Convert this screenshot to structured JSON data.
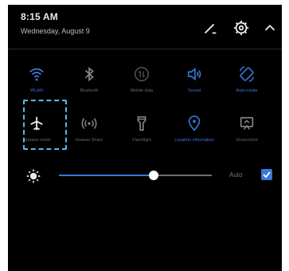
{
  "status": {
    "time": "8:15 AM",
    "date": "Wednesday, August 9"
  },
  "header_icons": [
    "edit-icon",
    "gear-icon",
    "chevron-up-icon"
  ],
  "tiles": [
    {
      "label": "WLAN",
      "icon": "wifi-icon",
      "active": true
    },
    {
      "label": "Bluetooth",
      "icon": "bluetooth-icon",
      "active": false
    },
    {
      "label": "Mobile data",
      "icon": "mobile-data-icon",
      "active": false
    },
    {
      "label": "Sound",
      "icon": "sound-icon",
      "active": true
    },
    {
      "label": "Auto-rotate",
      "icon": "rotate-icon",
      "active": true
    },
    {
      "label": "Airplane mode",
      "icon": "airplane-icon",
      "active": false
    },
    {
      "label": "Huawei Share",
      "icon": "share-icon",
      "active": false
    },
    {
      "label": "Flashlight",
      "icon": "flashlight-icon",
      "active": false
    },
    {
      "label": "Location information",
      "icon": "location-icon",
      "active": true
    },
    {
      "label": "Screenshot",
      "icon": "screenshot-icon",
      "active": false
    }
  ],
  "brightness": {
    "level": 0.62,
    "auto_label": "Auto",
    "auto_checked": true
  },
  "colors": {
    "accent": "#3a78d9",
    "icon_white": "#e8e8e8",
    "icon_gray": "#8a8a8a",
    "focus_outline": "#5fb6e6"
  }
}
